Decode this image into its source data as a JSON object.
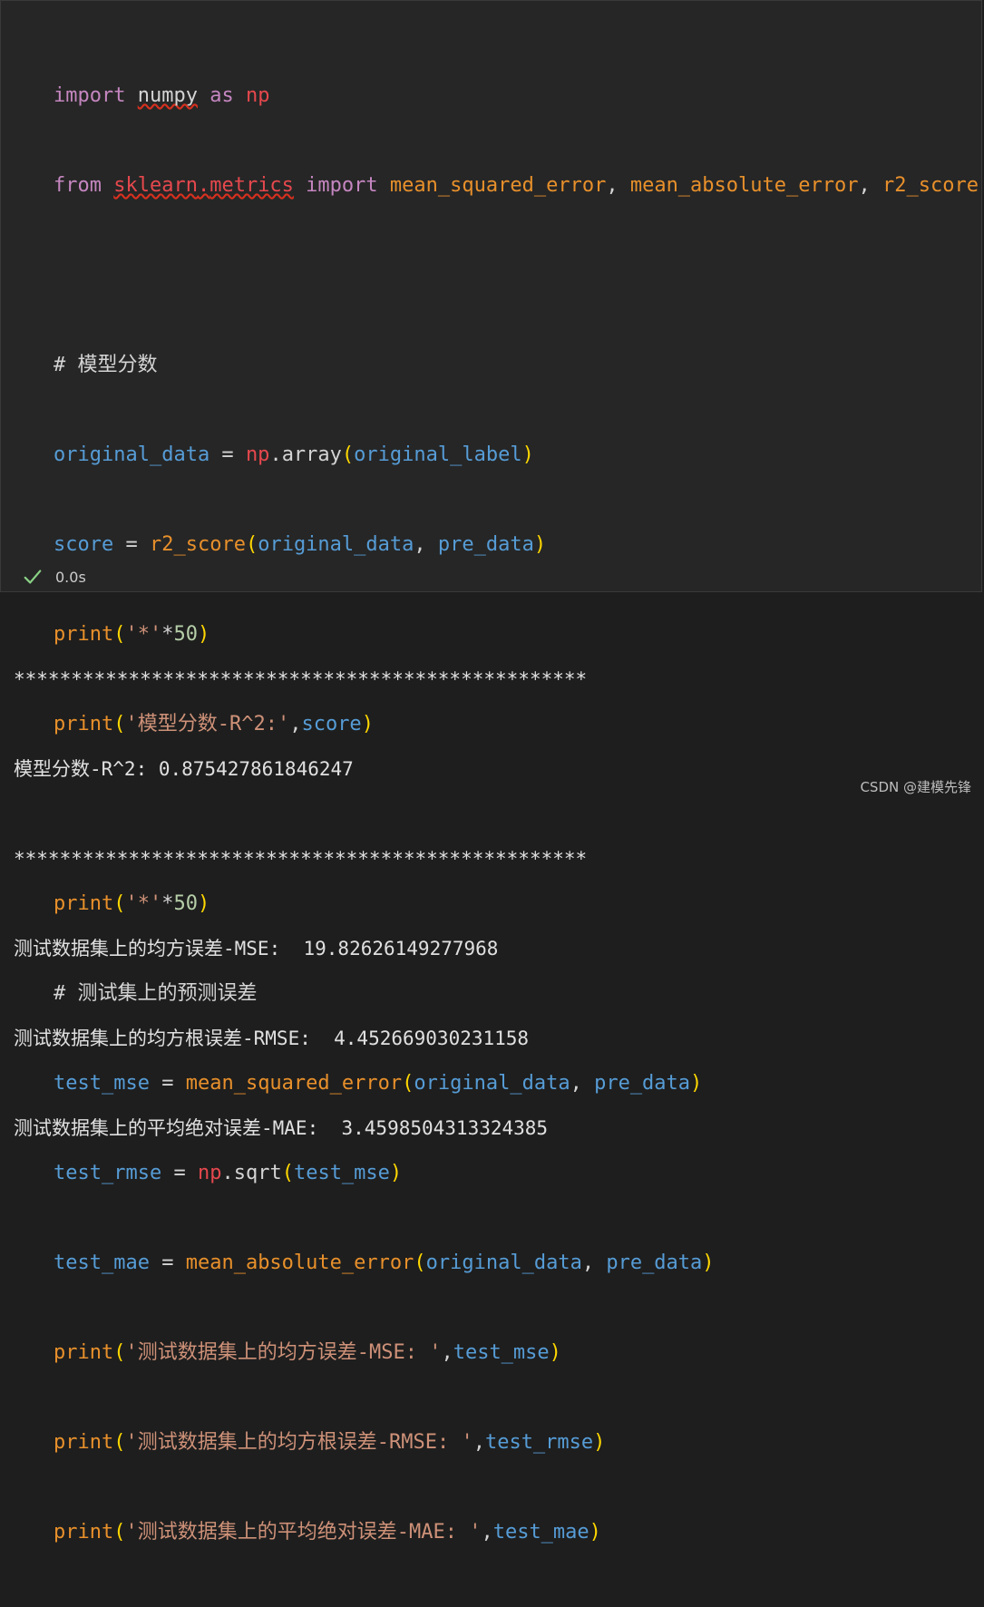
{
  "code": {
    "kw_import": "import",
    "kw_from": "from",
    "kw_as": "as",
    "mod_numpy": "numpy",
    "alias_np": "np",
    "mod_sklearn": "sklearn",
    "mod_metrics": "metrics",
    "fn_mse": "mean_squared_error",
    "fn_mae": "mean_absolute_error",
    "fn_r2": "r2_score",
    "fn_array": "array",
    "fn_sqrt": "sqrt",
    "fn_print": "print",
    "var_original_data": "original_data",
    "var_original_label": "original_label",
    "var_pre_data": "pre_data",
    "var_score": "score",
    "var_test_mse": "test_mse",
    "var_test_rmse": "test_rmse",
    "var_test_mae": "test_mae",
    "comment_score": "# 模型分数",
    "comment_errors": "# 测试集上的预测误差",
    "str_star": "'*'",
    "num_50": "50",
    "str_r2": "'模型分数-R^2:'",
    "str_mse": "'测试数据集上的均方误差-MSE: '",
    "str_rmse": "'测试数据集上的均方根误差-RMSE: '",
    "str_mae": "'测试数据集上的平均绝对误差-MAE: '"
  },
  "status": {
    "duration": "0.0s",
    "success_color": "#89d185",
    "icon": "check-icon"
  },
  "output": {
    "separator": "**************************************************",
    "r2_line": "模型分数-R^2: 0.875427861846247",
    "mse_line": "测试数据集上的均方误差-MSE:  19.82626149277968",
    "rmse_line": "测试数据集上的均方根误差-RMSE:  4.452669030231158",
    "mae_line": "测试数据集上的平均绝对误差-MAE:  3.4598504313324385"
  },
  "watermark": "CSDN @建模先锋"
}
